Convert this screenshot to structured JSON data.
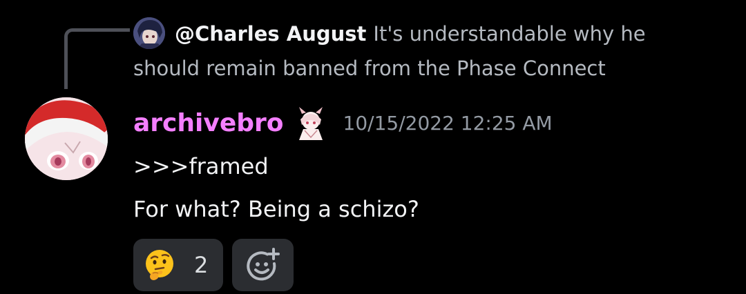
{
  "reply": {
    "author": "@Charles August",
    "text": "It's understandable why he should remain banned from the Phase Connect"
  },
  "message": {
    "username": "archivebro",
    "username_color": "#f47fff",
    "timestamp": "10/15/2022 12:25 AM",
    "lines": [
      ">>>framed",
      "For what? Being a schizo?"
    ]
  },
  "reactions": [
    {
      "emoji": "thinking-face-icon",
      "count": "2"
    }
  ],
  "add_reaction": {
    "icon": "add-reaction-icon"
  },
  "colors": {
    "background": "#000000",
    "reaction_bg": "#2b2d31",
    "muted_text": "#b5bac1",
    "timestamp": "#949ba4"
  }
}
